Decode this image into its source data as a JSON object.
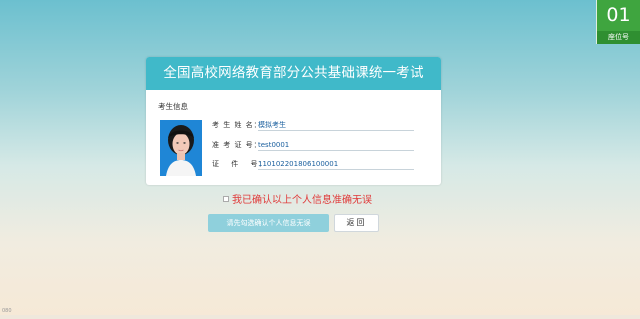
{
  "seat": {
    "number": "01",
    "label": "座位号"
  },
  "card": {
    "title": "全国高校网络教育部分公共基础课统一考试",
    "section_title": "考生信息",
    "fields": [
      {
        "label": "考 生 姓 名：",
        "value": "模拟考生"
      },
      {
        "label": "准 考 证 号：",
        "value": "test0001"
      },
      {
        "label": "证 　件 　号：",
        "value": "110102201806100001"
      }
    ]
  },
  "confirm_text": "我已确认以上个人信息准确无误",
  "buttons": {
    "confirm_label": "请先勾选确认个人信息无误",
    "back_label": "返回"
  },
  "footer": {
    "corner_text": "080"
  },
  "colors": {
    "header": "#40b9c9",
    "seat_badge": "#3fa53f",
    "confirm_text": "#e03a3a",
    "field_value": "#1a5f9e"
  }
}
